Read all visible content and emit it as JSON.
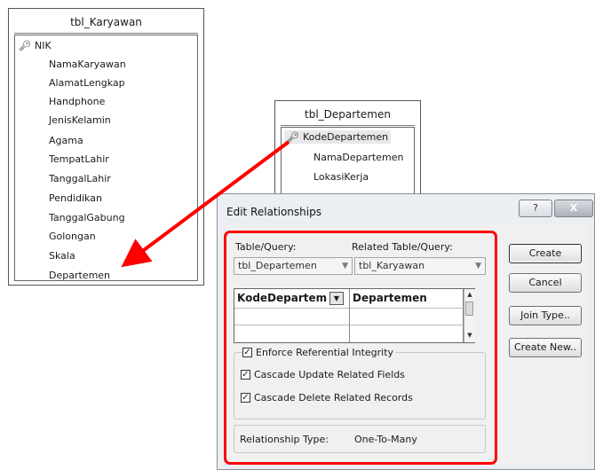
{
  "tbl_karyawan": {
    "title": "tbl_Karyawan",
    "fields": [
      "NIK",
      "NamaKaryawan",
      "AlamatLengkap",
      "Handphone",
      "JenisKelamin",
      "Agama",
      "TempatLahir",
      "TanggalLahir",
      "Pendidikan",
      "TanggalGabung",
      "Golongan",
      "Skala",
      "Departemen"
    ]
  },
  "tbl_departemen": {
    "title": "tbl_Departemen",
    "fields": [
      "KodeDepartemen",
      "NamaDepartemen",
      "LokasiKerja"
    ]
  },
  "dialog": {
    "title": "Edit Relationships",
    "help_label": "?",
    "close_label": "X",
    "table_query_label": "Table/Query:",
    "related_label": "Related Table/Query:",
    "table_value": "tbl_Departemen",
    "related_value": "tbl_Karyawan",
    "grid_left": "KodeDepartem",
    "grid_right": "Departemen",
    "enforce_label": "Enforce Referential Integrity",
    "cascade_update_label": "Cascade Update Related Fields",
    "cascade_delete_label": "Cascade Delete Related Records",
    "rel_type_label": "Relationship Type:",
    "rel_type_value": "One-To-Many",
    "create_label": "Create",
    "cancel_label": "Cancel",
    "join_label": "Join Type..",
    "create_new_label": "Create New.."
  },
  "colors": {
    "annotation": "#ff0000"
  }
}
